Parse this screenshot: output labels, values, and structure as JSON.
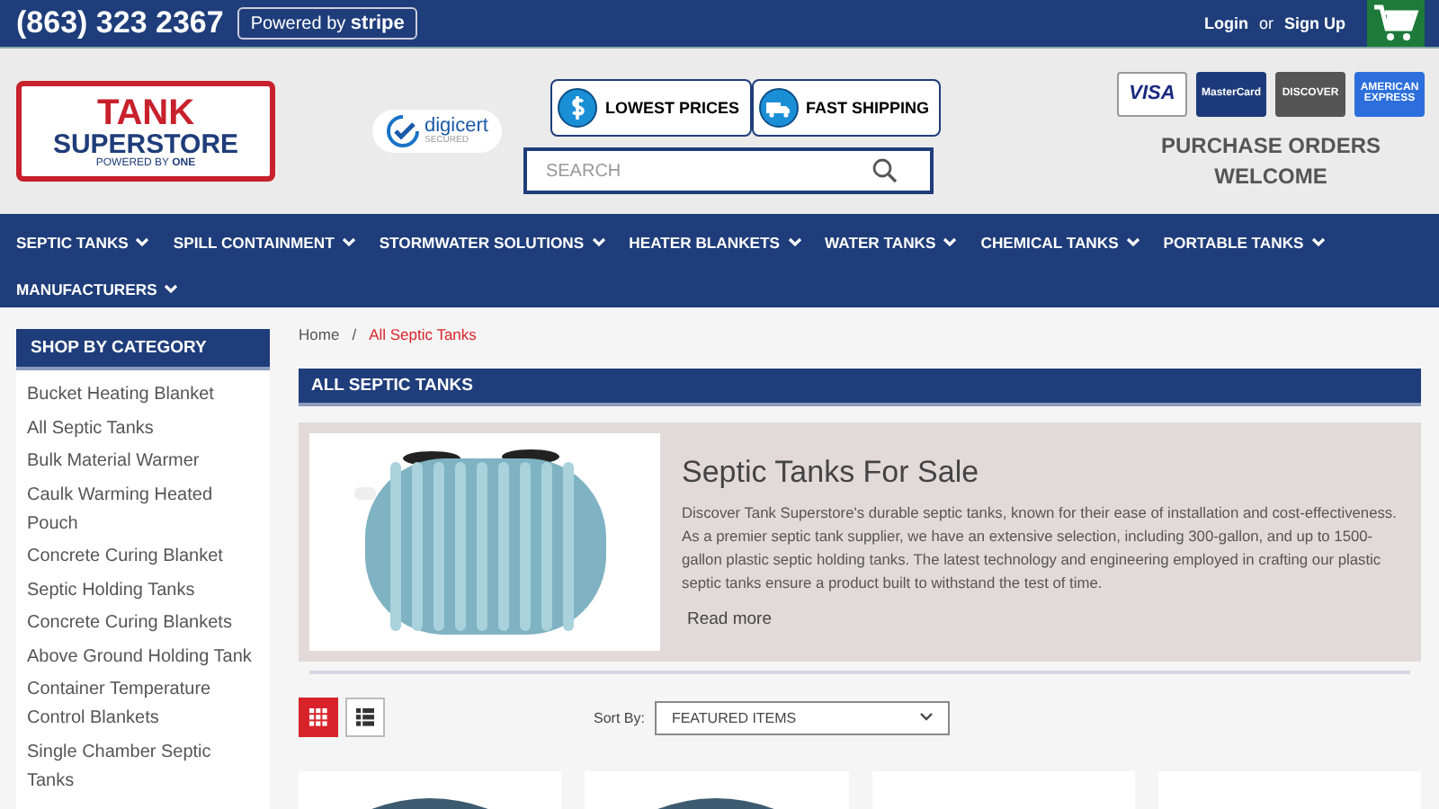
{
  "top_bar": {
    "phone": "(863) 323 2367",
    "stripe_badge": {
      "prefix": "Powered by",
      "brand": "stripe"
    },
    "login": "Login",
    "or": "or",
    "signup": "Sign Up"
  },
  "header": {
    "logo": {
      "line1": "TANK",
      "line2": "SUPERSTORE",
      "tagline": "POWERED BY",
      "brand": "ONE"
    },
    "digicert": {
      "name": "digicert",
      "sub": "SECURED"
    },
    "badges": [
      {
        "kind": "price",
        "label": "LOWEST PRICES"
      },
      {
        "kind": "shipping",
        "label": "FAST SHIPPING"
      }
    ],
    "search": {
      "placeholder": "SEARCH"
    },
    "cards": [
      {
        "kind": "visa",
        "label": "VISA"
      },
      {
        "kind": "mastercard",
        "label": "MasterCard"
      },
      {
        "kind": "discover",
        "label": "DISCOVER"
      },
      {
        "kind": "amex",
        "label": "AMERICAN EXPRESS"
      }
    ],
    "purchase_note": "PURCHASE ORDERS WELCOME"
  },
  "nav": [
    "SEPTIC TANKS",
    "SPILL CONTAINMENT",
    "STORMWATER SOLUTIONS",
    "HEATER BLANKETS",
    "WATER TANKS",
    "CHEMICAL TANKS",
    "PORTABLE TANKS",
    "MANUFACTURERS"
  ],
  "sidebar": {
    "title": "SHOP BY CATEGORY",
    "items": [
      "Bucket Heating Blanket",
      "All Septic Tanks",
      "Bulk Material Warmer",
      "Caulk Warming Heated Pouch",
      "Concrete Curing Blanket",
      "Septic Holding Tanks",
      "Concrete Curing Blankets",
      "Above Ground Holding Tank",
      "Container Temperature Control Blankets",
      "Single Chamber Septic Tanks"
    ]
  },
  "breadcrumbs": [
    {
      "label": "Home",
      "selected": false
    },
    {
      "label": "All Septic Tanks",
      "selected": true
    }
  ],
  "breadcrumb_separator": "/",
  "category_title": "ALL SEPTIC TANKS",
  "banner": {
    "heading": "Septic Tanks For Sale",
    "text": "Discover Tank Superstore's durable septic tanks, known for their ease of installation and cost-effectiveness. As a premier septic tank supplier, we have an extensive selection, including 300-gallon, and up to 1500-gallon plastic septic holding tanks. The latest technology and engineering employed in crafting our plastic septic tanks ensure a product built to withstand the test of time.",
    "link": "Read more"
  },
  "view_modes": [
    {
      "kind": "grid",
      "selected": true
    },
    {
      "kind": "list",
      "selected": false
    }
  ],
  "sort": {
    "label": "Sort By:",
    "value": "FEATURED ITEMS"
  },
  "products": [
    {
      "has_image": true
    },
    {
      "has_image": true
    },
    {
      "has_image": false
    },
    {
      "has_image": false
    }
  ]
}
